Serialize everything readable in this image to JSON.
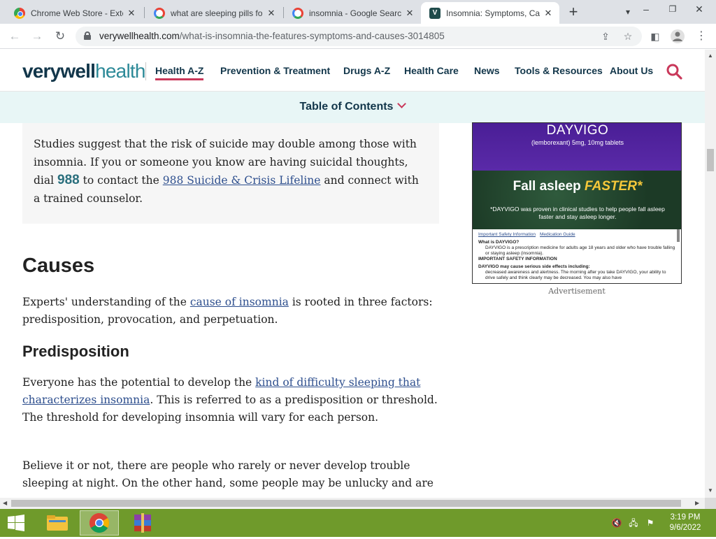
{
  "browser": {
    "tabs": [
      {
        "title": "Chrome Web Store - Exte",
        "favicon": "chrome-web-store-icon",
        "active": false
      },
      {
        "title": "what are sleeping pills fo",
        "favicon": "google-icon",
        "active": false
      },
      {
        "title": "insomnia - Google Search",
        "favicon": "google-icon",
        "active": false
      },
      {
        "title": "Insomnia: Symptoms, Ca",
        "favicon": "verywell-icon",
        "active": true
      }
    ],
    "url_domain": "verywellhealth.com",
    "url_path": "/what-is-insomnia-the-features-symptoms-and-causes-3014805"
  },
  "site": {
    "logo_part1": "verywell",
    "logo_part2": "health",
    "nav": [
      "Health A-Z",
      "Prevention & Treatment",
      "Drugs A-Z",
      "Health Care",
      "News",
      "Tools & Resources",
      "About Us"
    ],
    "current_nav": "Health A-Z",
    "toc_label": "Table of Contents",
    "accent_color": "#c9385a",
    "brand_color": "#12364a"
  },
  "article": {
    "callout": {
      "text1": "Studies suggest that the risk of suicide may double among those with insomnia. If you or someone you know are having suicidal thoughts, dial ",
      "number": "988",
      "text2": " to contact the ",
      "link": "988 Suicide & Crisis Lifeline",
      "text3": " and connect with a trained counselor."
    },
    "causes_heading": "Causes",
    "causes_p1": "Experts' understanding of the ",
    "causes_link": "cause of insomnia",
    "causes_p2": " is rooted in three factors: predisposition, provocation, and perpetuation.",
    "predisposition_heading": "Predisposition",
    "pred_p1": "Everyone has the potential to develop the ",
    "pred_link": "kind of difficulty sleeping that characterizes insomnia",
    "pred_p2": ". This is referred to as a predisposition or threshold. The threshold for developing insomnia will vary for each person.",
    "pred_p3": "Believe it or not, there are people who rarely or never develop trouble sleeping at night. On the other hand, some people may be unlucky and are"
  },
  "ad": {
    "brand": "DAYVIGO",
    "sub": "(lemborexant) 5mg, 10mg tablets",
    "headline1": "Fall asleep ",
    "headline2": "FASTER*",
    "body": "*DAYVIGO was proven in clinical studies to help people fall asleep faster and stay asleep longer.",
    "link1": "Important Safety Information",
    "link2": "Medication Guide",
    "info_q": "What is DAYVIGO?",
    "info_a": "DAYVIGO is a prescription medicine for adults age 18 years and older who have trouble falling or staying asleep (insomnia).",
    "info_h": "IMPORTANT SAFETY INFORMATION",
    "info_h2": "DAYVIGO may cause serious side effects including:",
    "info_b": "decreased awareness and alertness. The morning after you take DAYVIGO, your ability to drive safely and think clearly may be decreased. You may also have",
    "label": "Advertisement"
  },
  "taskbar": {
    "time": "3:19 PM",
    "date": "9/6/2022"
  }
}
